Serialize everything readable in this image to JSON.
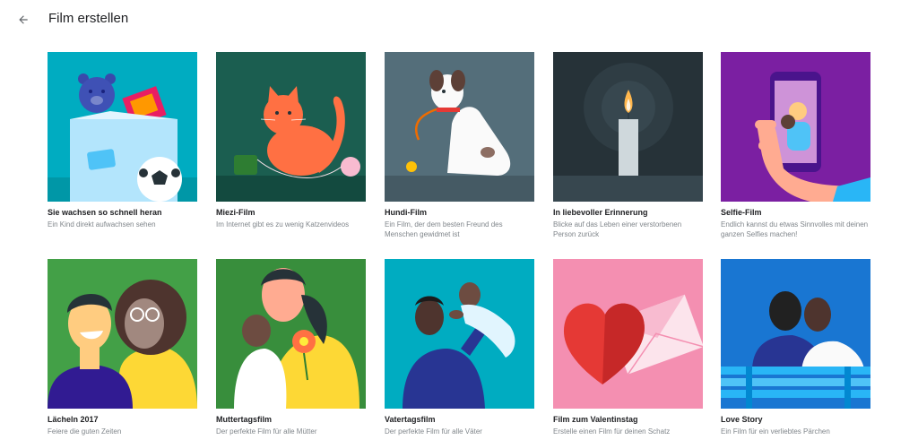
{
  "header": {
    "back_icon": "arrow-back-icon",
    "title": "Film erstellen"
  },
  "cards": [
    {
      "title": "Sie wachsen so schnell heran",
      "description": "Ein Kind direkt aufwachsen sehen",
      "bg": "#00acc1",
      "illustration": "teddy-bear-toybox"
    },
    {
      "title": "Miezi-Film",
      "description": "Im Internet gibt es zu wenig Katzenvideos",
      "bg": "#1b5e50",
      "illustration": "cat-with-yarn"
    },
    {
      "title": "Hundi-Film",
      "description": "Ein Film, der dem besten Freund des Menschen gewidmet ist",
      "bg": "#546e7a",
      "illustration": "dog-with-leash"
    },
    {
      "title": "In liebevoller Erinnerung",
      "description": "Blicke auf das Leben einer verstorbenen Person zurück",
      "bg": "#263238",
      "illustration": "candle"
    },
    {
      "title": "Selfie-Film",
      "description": "Endlich kannst du etwas Sinnvolles mit deinen ganzen Selfies machen!",
      "bg": "#7b1fa2",
      "illustration": "hand-holding-phone"
    },
    {
      "title": "Lächeln 2017",
      "description": "Feiere die guten Zeiten",
      "bg": "#43a047",
      "illustration": "smiling-couple"
    },
    {
      "title": "Muttertagsfilm",
      "description": "Der perfekte Film für alle Mütter",
      "bg": "#388e3c",
      "illustration": "mother-and-child"
    },
    {
      "title": "Vatertagsfilm",
      "description": "Der perfekte Film für alle Väter",
      "bg": "#00acc1",
      "illustration": "father-lifting-baby"
    },
    {
      "title": "Film zum Valentinstag",
      "description": "Erstelle einen Film für deinen Schatz",
      "bg": "#f48fb1",
      "illustration": "heart-and-envelope"
    },
    {
      "title": "Love Story",
      "description": "Ein Film für ein verliebtes Pärchen",
      "bg": "#1976d2",
      "illustration": "couple-on-bench"
    }
  ]
}
